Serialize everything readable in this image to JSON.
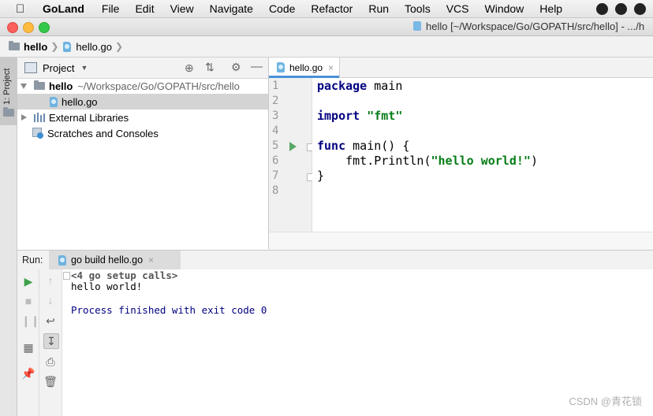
{
  "menubar": {
    "app_name": "GoLand",
    "items": [
      "File",
      "Edit",
      "View",
      "Navigate",
      "Code",
      "Refactor",
      "Run",
      "Tools",
      "VCS",
      "Window",
      "Help"
    ]
  },
  "window": {
    "title": "hello [~/Workspace/Go/GOPATH/src/hello] - .../h"
  },
  "navbar": {
    "crumb_project": "hello",
    "crumb_file": "hello.go"
  },
  "left_strip": {
    "project_tab": "1: Project"
  },
  "project_panel": {
    "title": "Project",
    "tree": {
      "root_name": "hello",
      "root_path": "~/Workspace/Go/GOPATH/src/hello",
      "file": "hello.go",
      "external_libraries": "External Libraries",
      "scratches": "Scratches and Consoles"
    }
  },
  "editor": {
    "tab_label": "hello.go",
    "line_numbers": [
      "1",
      "2",
      "3",
      "4",
      "5",
      "6",
      "7",
      "8"
    ],
    "code": {
      "l1_kw": "package",
      "l1_rest": " main",
      "l3_kw": "import",
      "l3_str": "\"fmt\"",
      "l5_kw": "func",
      "l5_rest": " main() {",
      "l6_pre": "    fmt.Println(",
      "l6_str": "\"hello world!\"",
      "l6_post": ")",
      "l7": "}"
    }
  },
  "run_panel": {
    "label": "Run:",
    "tab_label": "go build hello.go",
    "console": {
      "setup_calls": "<4 go setup calls>",
      "output": "hello world!",
      "exit_message": "Process finished with exit code 0"
    }
  },
  "watermark": "CSDN @青花锁",
  "colors": {
    "keyword": "#000080",
    "string": "#067d17",
    "current_line": "#fffae3",
    "console_info": "#000080",
    "selection": "#d4d4d4"
  }
}
